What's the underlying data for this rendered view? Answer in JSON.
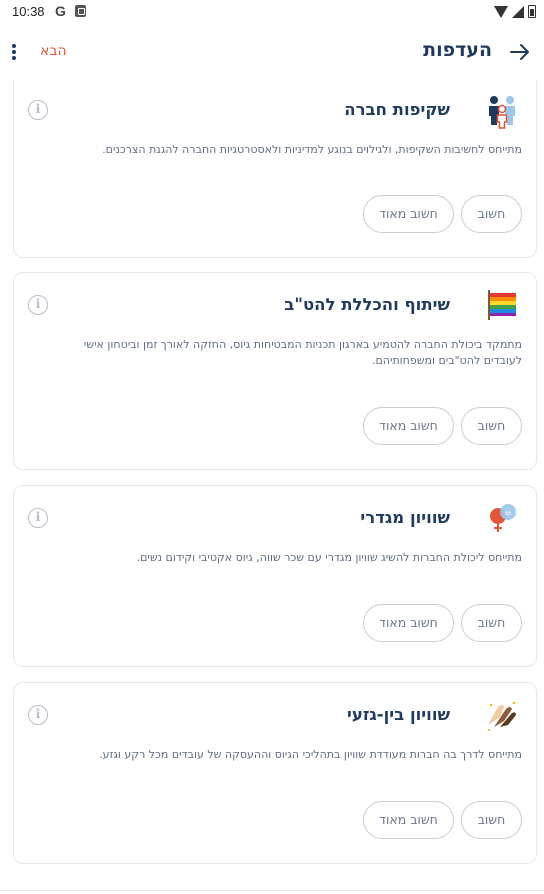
{
  "status_bar": {
    "time": "10:38",
    "g_label": "G"
  },
  "app_bar": {
    "title": "העדפות",
    "next_label": "הבא"
  },
  "colors": {
    "accent": "#e2573a",
    "title": "#1f3a5c",
    "text": "#5f6f85",
    "border": "#e4e8ee"
  },
  "buttons": {
    "important": "חשוב",
    "very_important": "חשוב מאוד"
  },
  "cards": [
    {
      "icon": "people-transparency-icon",
      "title": "שקיפות חברה",
      "description": "מתייחס לחשיבות השקיפות, ולגילוים בנוגע למדיניות ולאסטרטגיות החברה להגנת הצרכנים."
    },
    {
      "icon": "rainbow-flag-icon",
      "title": "שיתוף והכללת להט\"ב",
      "description": "מתמקד ביכולת החברה להטמיע בארגון תכניות המבטיחות גיוס, החזקה לאורך זמן וביטחון אישי לעובדים להט\"בים ומשפחותיהם."
    },
    {
      "icon": "gender-equality-icon",
      "title": "שוויון מגדרי",
      "description": "מתייחס ליכולת החברות להשיג שוויון מגדרי עם שכר שווה, גיוס אקטיבי וקידום נשים."
    },
    {
      "icon": "racial-equality-hands-icon",
      "title": "שוויון בין-גזעי",
      "description": "מתייחס לדרך בה חברות מעודדת שוויון בתהליכי הגיוס וההעסקה של עובדים מכל רקע וגזע."
    }
  ]
}
